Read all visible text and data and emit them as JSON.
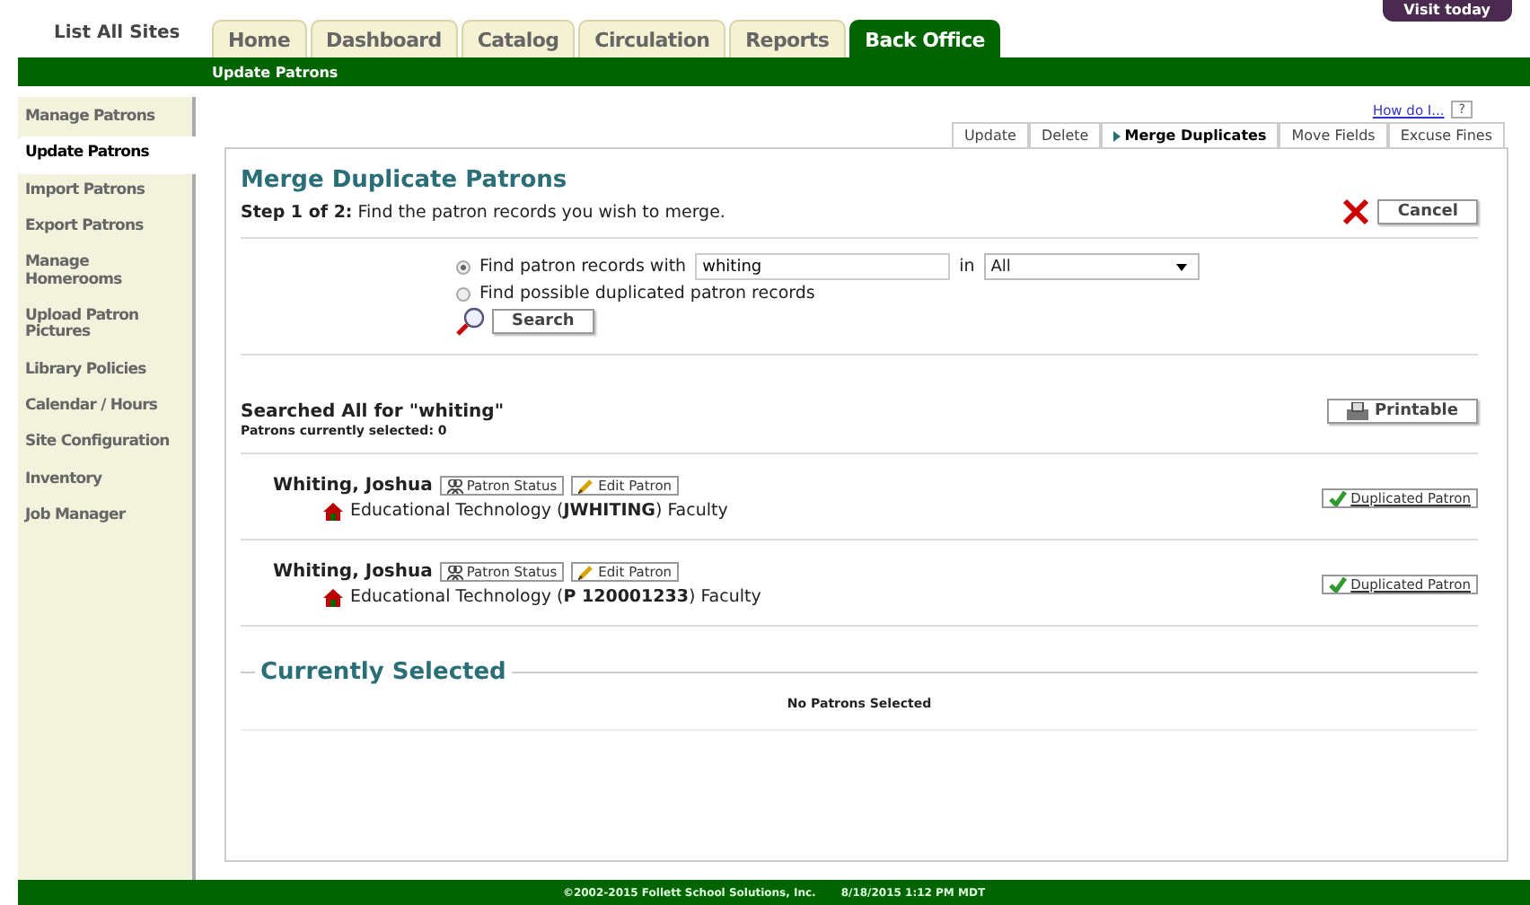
{
  "header": {
    "site_link": "List All Sites",
    "top_button": "Visit today"
  },
  "tabs": [
    {
      "label": "Home",
      "selected": false
    },
    {
      "label": "Dashboard",
      "selected": false
    },
    {
      "label": "Catalog",
      "selected": false
    },
    {
      "label": "Circulation",
      "selected": false
    },
    {
      "label": "Reports",
      "selected": false
    },
    {
      "label": "Back Office",
      "selected": true
    }
  ],
  "subtitle": "Update Patrons",
  "sidebar": {
    "items": [
      {
        "label": "Manage Patrons",
        "selected": false
      },
      {
        "label": "Update Patrons",
        "selected": true
      },
      {
        "label": "Import Patrons",
        "selected": false
      },
      {
        "label": "Export Patrons",
        "selected": false
      },
      {
        "label": "Manage Homerooms",
        "selected": false
      },
      {
        "label": "Upload Patron Pictures",
        "selected": false
      },
      {
        "label": "Library Policies",
        "selected": false
      },
      {
        "label": "Calendar / Hours",
        "selected": false
      },
      {
        "label": "Site Configuration",
        "selected": false
      },
      {
        "label": "Inventory",
        "selected": false
      },
      {
        "label": "Job Manager",
        "selected": false
      }
    ]
  },
  "help": {
    "link": "How do I...",
    "button": "?"
  },
  "subtabs": [
    {
      "label": "Update",
      "selected": false
    },
    {
      "label": "Delete",
      "selected": false
    },
    {
      "label": "Merge Duplicates",
      "selected": true
    },
    {
      "label": "Move Fields",
      "selected": false
    },
    {
      "label": "Excuse Fines",
      "selected": false
    }
  ],
  "title": "Merge Duplicate Patrons",
  "step": "**Step 1 of 2:** Find the patron records you wish to merge.",
  "cancel": "Cancel",
  "search_options": [
    {
      "label": "Find patron records with",
      "selected": true
    },
    {
      "label": "Find possible duplicated patron records",
      "selected": false
    }
  ],
  "search_field": {
    "value": "whiting"
  },
  "in_label": "in",
  "scope": "All",
  "search_button": "Search",
  "results_heading": "Searched All for \"whiting\"",
  "selected_count": "Patrons currently selected: 0",
  "printable": "Printable",
  "patrons": [
    {
      "name": "Whiting, Joshua",
      "status_button": "Patron Status",
      "edit_button": "Edit Patron",
      "detail": "Educational Technology (**JWHITING**) Faculty",
      "duplicate_button": "Duplicated Patron"
    },
    {
      "name": "Whiting, Joshua",
      "status_button": "Patron Status",
      "edit_button": "Edit Patron",
      "detail": "Educational Technology (**P 120001233**) Faculty",
      "duplicate_button": "Duplicated Patron"
    }
  ],
  "currently_selected": {
    "title": "Currently Selected",
    "message": "No Patrons Selected"
  },
  "footer": [
    "©2002-2015 Follett School Solutions, Inc.",
    "8/18/2015 1:12 PM MDT"
  ]
}
